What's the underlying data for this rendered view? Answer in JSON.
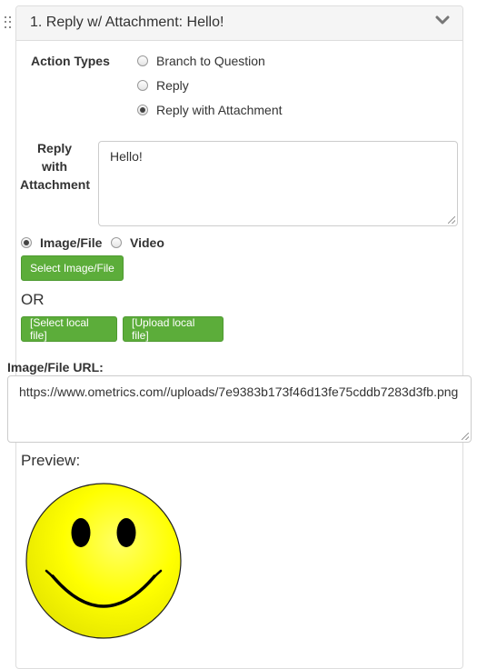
{
  "panel": {
    "title": "1. Reply w/ Attachment: Hello!",
    "collapse_icon": "chevron-down-icon"
  },
  "action_types": {
    "label": "Action Types",
    "options": [
      {
        "label": "Branch to Question",
        "checked": false
      },
      {
        "label": "Reply",
        "checked": false
      },
      {
        "label": "Reply with Attachment",
        "checked": true
      }
    ]
  },
  "reply": {
    "label_line1": "Reply",
    "label_line2": "with",
    "label_line3": "Attachment",
    "value": "Hello!"
  },
  "media_type": {
    "options": [
      {
        "label": "Image/File",
        "checked": true
      },
      {
        "label": "Video",
        "checked": false
      }
    ]
  },
  "buttons": {
    "select_image": "Select Image/File",
    "or_text": "OR",
    "select_local": "[Select local file]",
    "upload_local": "[Upload local file]"
  },
  "url": {
    "label": "Image/File URL:",
    "value": "https://www.ometrics.com//uploads/7e9383b173f46d13fe75cddb7283d3fb.png"
  },
  "preview": {
    "label": "Preview:",
    "image": "smiley-face"
  },
  "colors": {
    "button_green": "#5cad3a",
    "smiley_yellow": "#ffff00"
  }
}
